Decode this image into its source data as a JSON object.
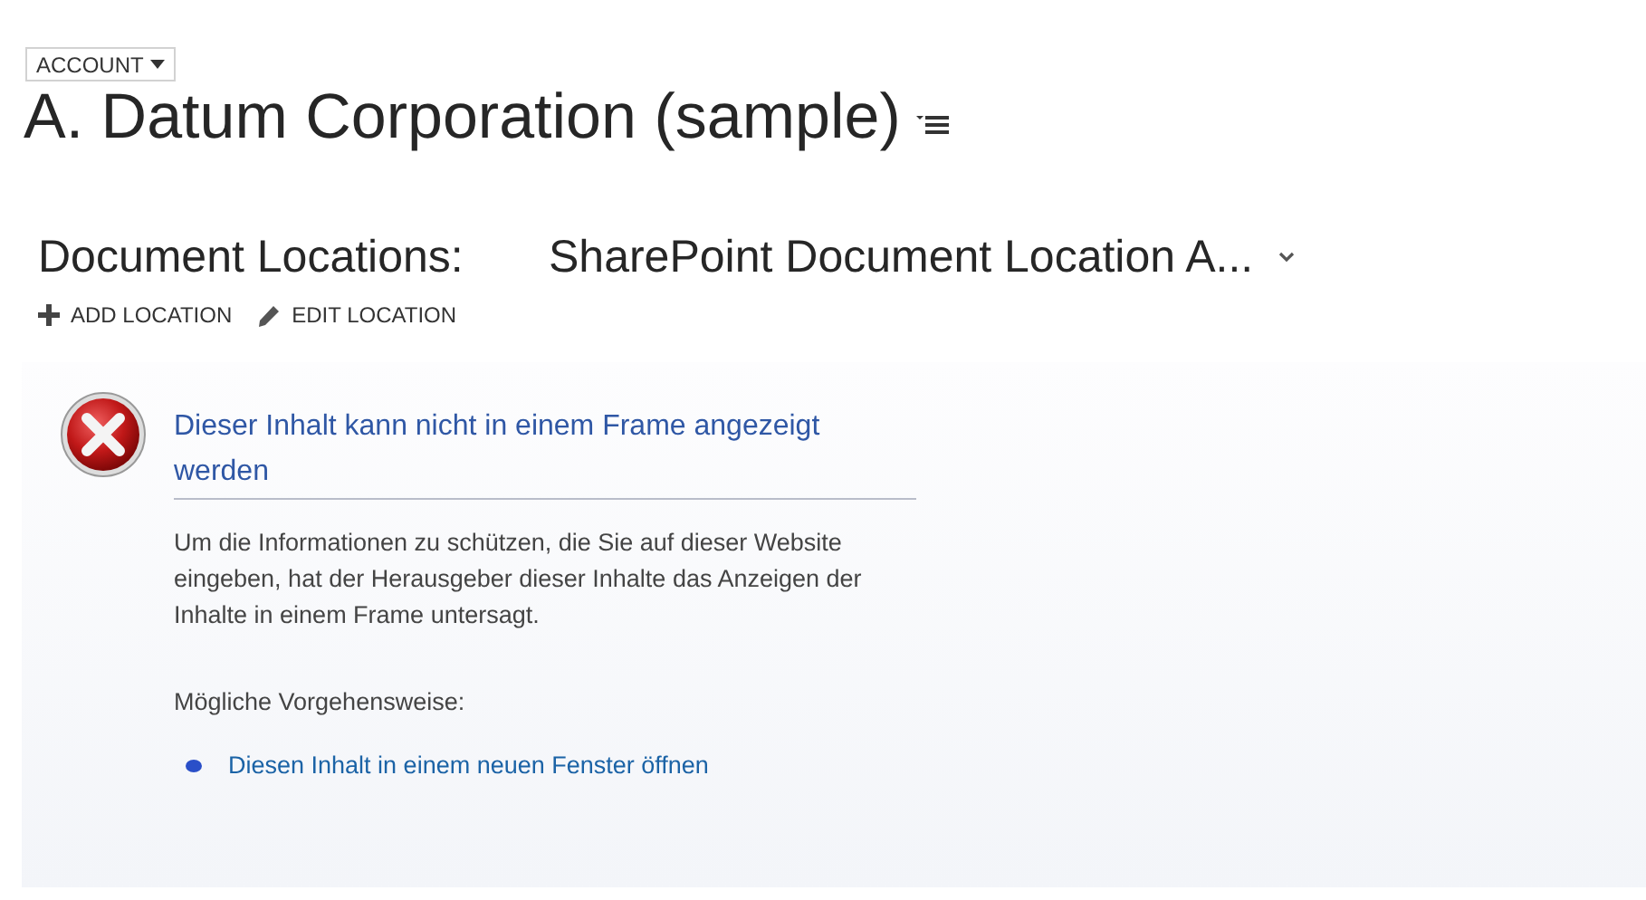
{
  "entity_switcher": {
    "label": "ACCOUNT"
  },
  "title": "A. Datum Corporation (sample)",
  "document_locations": {
    "label": "Document Locations:",
    "value": "SharePoint Document Location A..."
  },
  "actions": [
    {
      "kind": "add",
      "label": "ADD LOCATION"
    },
    {
      "kind": "edit",
      "label": "EDIT LOCATION"
    }
  ],
  "frame_error": {
    "heading": "Dieser Inhalt kann nicht in einem Frame angezeigt werden",
    "message": "Um die Informationen zu schützen, die Sie auf dieser Website eingeben, hat der Herausgeber dieser Inhalte das Anzeigen der Inhalte in einem Frame untersagt.",
    "options_label": "Mögliche Vorgehensweise:",
    "links": [
      "Diesen Inhalt in einem neuen Fenster öffnen"
    ]
  }
}
